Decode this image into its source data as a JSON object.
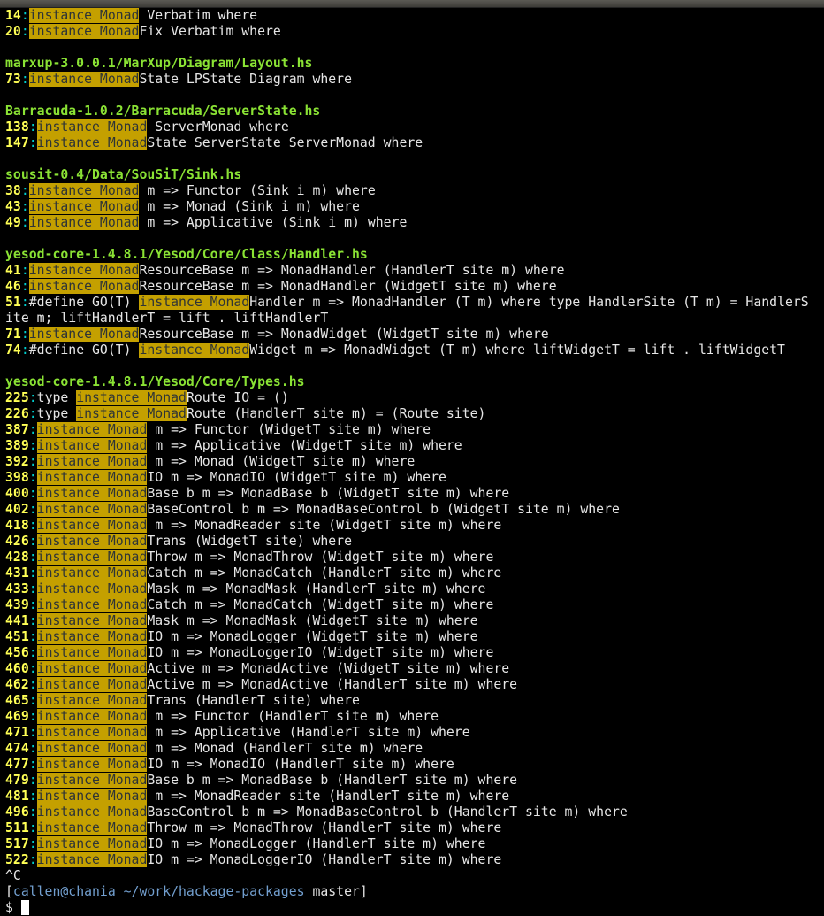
{
  "window": {
    "title": ""
  },
  "highlight": "instance Monad",
  "lines": [
    {
      "type": "match",
      "num": "14",
      "pre": "",
      "post": " Verbatim where"
    },
    {
      "type": "match",
      "num": "20",
      "pre": "",
      "post": "Fix Verbatim where"
    },
    {
      "type": "blank"
    },
    {
      "type": "file",
      "text": "marxup-3.0.0.1/MarXup/Diagram/Layout.hs"
    },
    {
      "type": "match",
      "num": "73",
      "pre": "",
      "post": "State LPState Diagram where"
    },
    {
      "type": "blank"
    },
    {
      "type": "file",
      "text": "Barracuda-1.0.2/Barracuda/ServerState.hs"
    },
    {
      "type": "match",
      "num": "138",
      "pre": "",
      "post": " ServerMonad where"
    },
    {
      "type": "match",
      "num": "147",
      "pre": "",
      "post": "State ServerState ServerMonad where"
    },
    {
      "type": "blank"
    },
    {
      "type": "file",
      "text": "sousit-0.4/Data/SouSiT/Sink.hs"
    },
    {
      "type": "match",
      "num": "38",
      "pre": "",
      "post": " m => Functor (Sink i m) where"
    },
    {
      "type": "match",
      "num": "43",
      "pre": "",
      "post": " m => Monad (Sink i m) where"
    },
    {
      "type": "match",
      "num": "49",
      "pre": "",
      "post": " m => Applicative (Sink i m) where"
    },
    {
      "type": "blank"
    },
    {
      "type": "file",
      "text": "yesod-core-1.4.8.1/Yesod/Core/Class/Handler.hs"
    },
    {
      "type": "match",
      "num": "41",
      "pre": "",
      "post": "ResourceBase m => MonadHandler (HandlerT site m) where"
    },
    {
      "type": "match",
      "num": "46",
      "pre": "",
      "post": "ResourceBase m => MonadHandler (WidgetT site m) where"
    },
    {
      "type": "match",
      "num": "51",
      "pre": "#define GO(T) ",
      "post": "Handler m => MonadHandler (T m) where type HandlerSite (T m) = HandlerS"
    },
    {
      "type": "plain",
      "text": "ite m; liftHandlerT = lift . liftHandlerT"
    },
    {
      "type": "match",
      "num": "71",
      "pre": "",
      "post": "ResourceBase m => MonadWidget (WidgetT site m) where"
    },
    {
      "type": "match",
      "num": "74",
      "pre": "#define GO(T) ",
      "post": "Widget m => MonadWidget (T m) where liftWidgetT = lift . liftWidgetT"
    },
    {
      "type": "blank"
    },
    {
      "type": "file",
      "text": "yesod-core-1.4.8.1/Yesod/Core/Types.hs"
    },
    {
      "type": "match",
      "num": "225",
      "pre": "type ",
      "post": "Route IO = ()"
    },
    {
      "type": "match",
      "num": "226",
      "pre": "type ",
      "post": "Route (HandlerT site m) = (Route site)"
    },
    {
      "type": "match",
      "num": "387",
      "pre": "",
      "post": " m => Functor (WidgetT site m) where"
    },
    {
      "type": "match",
      "num": "389",
      "pre": "",
      "post": " m => Applicative (WidgetT site m) where"
    },
    {
      "type": "match",
      "num": "392",
      "pre": "",
      "post": " m => Monad (WidgetT site m) where"
    },
    {
      "type": "match",
      "num": "398",
      "pre": "",
      "post": "IO m => MonadIO (WidgetT site m) where"
    },
    {
      "type": "match",
      "num": "400",
      "pre": "",
      "post": "Base b m => MonadBase b (WidgetT site m) where"
    },
    {
      "type": "match",
      "num": "402",
      "pre": "",
      "post": "BaseControl b m => MonadBaseControl b (WidgetT site m) where"
    },
    {
      "type": "match",
      "num": "418",
      "pre": "",
      "post": " m => MonadReader site (WidgetT site m) where"
    },
    {
      "type": "match",
      "num": "426",
      "pre": "",
      "post": "Trans (WidgetT site) where"
    },
    {
      "type": "match",
      "num": "428",
      "pre": "",
      "post": "Throw m => MonadThrow (WidgetT site m) where"
    },
    {
      "type": "match",
      "num": "431",
      "pre": "",
      "post": "Catch m => MonadCatch (HandlerT site m) where"
    },
    {
      "type": "match",
      "num": "433",
      "pre": "",
      "post": "Mask m => MonadMask (HandlerT site m) where"
    },
    {
      "type": "match",
      "num": "439",
      "pre": "",
      "post": "Catch m => MonadCatch (WidgetT site m) where"
    },
    {
      "type": "match",
      "num": "441",
      "pre": "",
      "post": "Mask m => MonadMask (WidgetT site m) where"
    },
    {
      "type": "match",
      "num": "451",
      "pre": "",
      "post": "IO m => MonadLogger (WidgetT site m) where"
    },
    {
      "type": "match",
      "num": "456",
      "pre": "",
      "post": "IO m => MonadLoggerIO (WidgetT site m) where"
    },
    {
      "type": "match",
      "num": "460",
      "pre": "",
      "post": "Active m => MonadActive (WidgetT site m) where"
    },
    {
      "type": "match",
      "num": "462",
      "pre": "",
      "post": "Active m => MonadActive (HandlerT site m) where"
    },
    {
      "type": "match",
      "num": "465",
      "pre": "",
      "post": "Trans (HandlerT site) where"
    },
    {
      "type": "match",
      "num": "469",
      "pre": "",
      "post": " m => Functor (HandlerT site m) where"
    },
    {
      "type": "match",
      "num": "471",
      "pre": "",
      "post": " m => Applicative (HandlerT site m) where"
    },
    {
      "type": "match",
      "num": "474",
      "pre": "",
      "post": " m => Monad (HandlerT site m) where"
    },
    {
      "type": "match",
      "num": "477",
      "pre": "",
      "post": "IO m => MonadIO (HandlerT site m) where"
    },
    {
      "type": "match",
      "num": "479",
      "pre": "",
      "post": "Base b m => MonadBase b (HandlerT site m) where"
    },
    {
      "type": "match",
      "num": "481",
      "pre": "",
      "post": " m => MonadReader site (HandlerT site m) where"
    },
    {
      "type": "match",
      "num": "496",
      "pre": "",
      "post": "BaseControl b m => MonadBaseControl b (HandlerT site m) where"
    },
    {
      "type": "match",
      "num": "511",
      "pre": "",
      "post": "Throw m => MonadThrow (HandlerT site m) where"
    },
    {
      "type": "match",
      "num": "517",
      "pre": "",
      "post": "IO m => MonadLogger (HandlerT site m) where"
    },
    {
      "type": "match",
      "num": "522",
      "pre": "",
      "post": "IO m => MonadLoggerIO (HandlerT site m) where"
    },
    {
      "type": "plain",
      "text": "^C"
    },
    {
      "type": "prompt",
      "open": "[",
      "user": "callen@chania",
      "path": " ~/work/hackage-packages",
      "branch": " master",
      "close": "]"
    },
    {
      "type": "input",
      "text": "$ "
    }
  ],
  "colors": {
    "background": "#000000",
    "text": "#e6e6e6",
    "line_number": "#ffff55",
    "separator": "#00cdcd",
    "filename": "#8ae234",
    "highlight_bg": "#c4a000",
    "highlight_fg": "#2e3436",
    "prompt": "#729fcf"
  }
}
